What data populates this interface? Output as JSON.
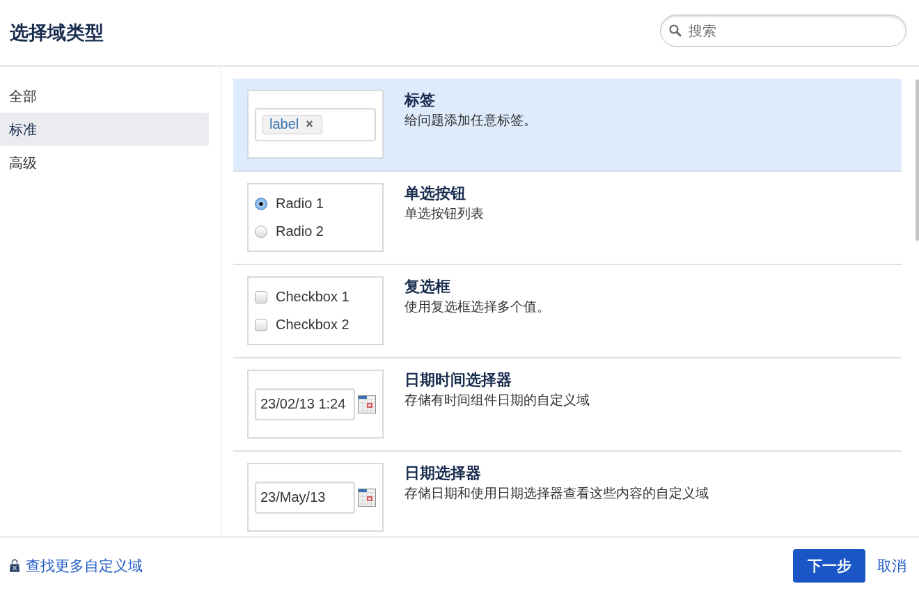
{
  "dialog": {
    "title": "选择域类型",
    "search": {
      "placeholder": "搜索"
    }
  },
  "sidebar": {
    "items": [
      {
        "label": "全部",
        "selected": false
      },
      {
        "label": "标准",
        "selected": true
      },
      {
        "label": "高级",
        "selected": false
      }
    ]
  },
  "field_types": [
    {
      "kind": "tags",
      "title": "标签",
      "description": "给问题添加任意标签。",
      "selected": true,
      "preview": {
        "tag": "label",
        "remove": "×"
      }
    },
    {
      "kind": "radio",
      "title": "单选按钮",
      "description": "单选按钮列表",
      "selected": false,
      "preview": {
        "options": [
          {
            "label": "Radio 1",
            "selected": true
          },
          {
            "label": "Radio 2",
            "selected": false
          }
        ]
      }
    },
    {
      "kind": "checkbox",
      "title": "复选框",
      "description": "使用复选框选择多个值。",
      "selected": false,
      "preview": {
        "options": [
          {
            "label": "Checkbox 1",
            "checked": false
          },
          {
            "label": "Checkbox 2",
            "checked": false
          }
        ]
      }
    },
    {
      "kind": "date",
      "title": "日期时间选择器",
      "description": "存储有时间组件日期的自定义域",
      "selected": false,
      "preview": {
        "value": "23/02/13 1:24"
      }
    },
    {
      "kind": "date",
      "title": "日期选择器",
      "description": "存储日期和使用日期选择器查看这些内容的自定义域",
      "selected": false,
      "preview": {
        "value": "23/May/13"
      }
    }
  ],
  "footer": {
    "link": "查找更多自定义域",
    "primary_button": "下一步",
    "cancel": "取消"
  }
}
